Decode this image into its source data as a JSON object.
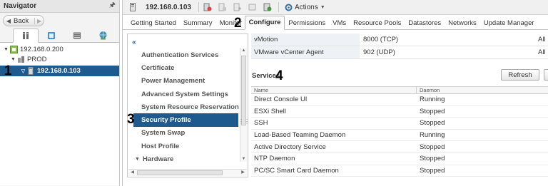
{
  "navigator": {
    "title": "Navigator",
    "back_label": "Back",
    "tabs": [
      {
        "name": "hosts-clusters-icon"
      },
      {
        "name": "vms-templates-icon"
      },
      {
        "name": "storage-icon"
      },
      {
        "name": "networking-icon"
      }
    ],
    "tree": {
      "root": "192.168.0.200",
      "datacenter": "PROD",
      "host": "192.168.0.103"
    }
  },
  "object": {
    "name": "192.168.0.103",
    "actions_label": "Actions"
  },
  "tabs": [
    "Getting Started",
    "Summary",
    "Monitor",
    "Configure",
    "Permissions",
    "VMs",
    "Resource Pools",
    "Datastores",
    "Networks",
    "Update Manager"
  ],
  "settings": {
    "items": [
      "Authentication Services",
      "Certificate",
      "Power Management",
      "Advanced System Settings",
      "System Resource Reservation",
      "Security Profile",
      "System Swap",
      "Host Profile"
    ],
    "group": "Hardware",
    "selected": "Security Profile"
  },
  "firewall_rows": [
    {
      "name": "vMotion",
      "value": "8000 (TCP)",
      "scope": "All"
    },
    {
      "name": "VMware vCenter Agent",
      "value": "902 (UDP)",
      "scope": "All"
    }
  ],
  "services": {
    "title": "Services",
    "refresh_label": "Refresh",
    "columns": [
      "Name",
      "Daemon"
    ],
    "rows": [
      {
        "name": "Direct Console UI",
        "daemon": "Running"
      },
      {
        "name": "ESXi Shell",
        "daemon": "Stopped"
      },
      {
        "name": "SSH",
        "daemon": "Stopped"
      },
      {
        "name": "Load-Based Teaming Daemon",
        "daemon": "Running"
      },
      {
        "name": "Active Directory Service",
        "daemon": "Stopped"
      },
      {
        "name": "NTP Daemon",
        "daemon": "Stopped"
      },
      {
        "name": "PC/SC Smart Card Daemon",
        "daemon": "Stopped"
      }
    ]
  },
  "annotations": [
    "1",
    "2",
    "3",
    "4"
  ]
}
